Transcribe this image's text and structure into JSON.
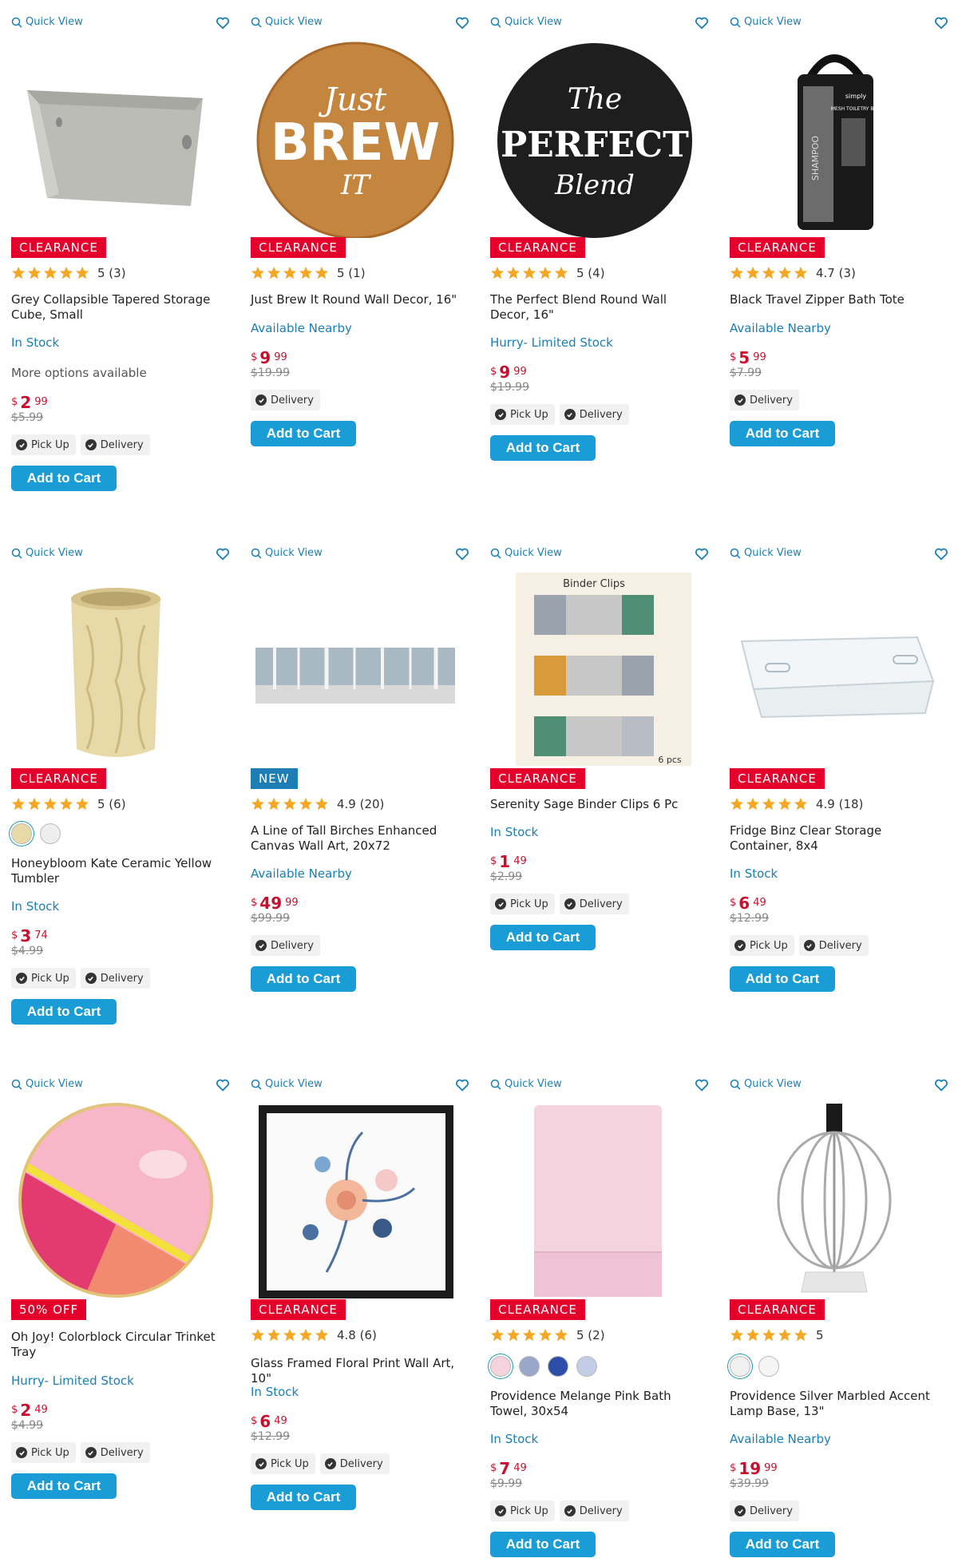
{
  "ui": {
    "quick_view": "Quick View",
    "add_to_cart": "Add to Cart",
    "pick_up": "Pick Up",
    "delivery": "Delivery",
    "more_options": "More options available",
    "currency": "$"
  },
  "colors": {
    "accent": "#1a9cd6",
    "price": "#c8102e",
    "badge_clearance": "#e4002b",
    "badge_new": "#1d7db5",
    "link": "#1a7fb5",
    "star": "#f5a623"
  },
  "products": [
    {
      "badge": "CLEARANCE",
      "badge_type": "clearance",
      "rating_text": "5 (3)",
      "title": "Grey Collapsible Tapered Storage Cube, Small",
      "availability": "In Stock",
      "more_options": true,
      "price_dollars": "2",
      "price_cents": "99",
      "was": "$5.99",
      "fulfillment": [
        "Pick Up",
        "Delivery"
      ],
      "image_icon": "storage-bin-icon"
    },
    {
      "badge": "CLEARANCE",
      "badge_type": "clearance",
      "rating_text": "5 (1)",
      "title": "Just Brew It Round Wall Decor, 16\"",
      "availability": "Available Nearby",
      "price_dollars": "9",
      "price_cents": "99",
      "was": "$19.99",
      "fulfillment": [
        "Delivery"
      ],
      "image_text": [
        "Just",
        "BREW",
        "IT"
      ],
      "image_icon": "wall-decor-icon"
    },
    {
      "badge": "CLEARANCE",
      "badge_type": "clearance",
      "rating_text": "5 (4)",
      "title": "The Perfect Blend Round Wall Decor, 16\"",
      "availability": "Hurry- Limited Stock",
      "price_dollars": "9",
      "price_cents": "99",
      "was": "$19.99",
      "fulfillment": [
        "Pick Up",
        "Delivery"
      ],
      "image_text": [
        "The",
        "PERFECT",
        "Blend"
      ],
      "image_icon": "wall-decor-icon"
    },
    {
      "badge": "CLEARANCE",
      "badge_type": "clearance",
      "rating_text": "4.7 (3)",
      "title": "Black Travel Zipper Bath Tote",
      "availability": "Available Nearby",
      "price_dollars": "5",
      "price_cents": "99",
      "was": "$7.99",
      "fulfillment": [
        "Delivery"
      ],
      "image_text": [
        "SHAMPOO",
        "simply",
        "MESH TOILETRY BAG"
      ],
      "image_icon": "bath-tote-icon"
    },
    {
      "badge": "CLEARANCE",
      "badge_type": "clearance",
      "rating_text": "5 (6)",
      "swatches": [
        "#e8d9a8",
        "#eeeeee"
      ],
      "title": "Honeybloom Kate Ceramic Yellow Tumbler",
      "availability": "In Stock",
      "price_dollars": "3",
      "price_cents": "74",
      "was": "$4.99",
      "fulfillment": [
        "Pick Up",
        "Delivery"
      ],
      "image_icon": "tumbler-icon"
    },
    {
      "badge": "NEW",
      "badge_type": "new",
      "rating_text": "4.9 (20)",
      "title": "A Line of Tall Birches Enhanced Canvas Wall Art, 20x72",
      "availability": "Available Nearby",
      "price_dollars": "49",
      "price_cents": "99",
      "was": "$99.99",
      "fulfillment": [
        "Delivery"
      ],
      "image_icon": "canvas-art-icon"
    },
    {
      "badge": "CLEARANCE",
      "badge_type": "clearance",
      "rating_text": "",
      "title": "Serenity Sage Binder Clips 6 Pc",
      "availability": "In Stock",
      "price_dollars": "1",
      "price_cents": "49",
      "was": "$2.99",
      "fulfillment": [
        "Pick Up",
        "Delivery"
      ],
      "image_text": [
        "Binder Clips",
        "6 pcs"
      ],
      "image_icon": "binder-clips-icon"
    },
    {
      "badge": "CLEARANCE",
      "badge_type": "clearance",
      "rating_text": "4.9 (18)",
      "title": "Fridge Binz Clear Storage Container, 8x4",
      "availability": "In Stock",
      "price_dollars": "6",
      "price_cents": "49",
      "was": "$12.99",
      "fulfillment": [
        "Pick Up",
        "Delivery"
      ],
      "image_icon": "clear-container-icon"
    },
    {
      "badge": "50% OFF",
      "badge_type": "clearance",
      "rating_text": "",
      "title": "Oh Joy! Colorblock Circular Trinket Tray",
      "availability": "Hurry- Limited Stock",
      "price_dollars": "2",
      "price_cents": "49",
      "was": "$4.99",
      "fulfillment": [
        "Pick Up",
        "Delivery"
      ],
      "image_icon": "trinket-tray-icon"
    },
    {
      "badge": "CLEARANCE",
      "badge_type": "clearance",
      "rating_text": "4.8 (6)",
      "title": "Glass Framed Floral Print Wall Art, 10\"",
      "availability": "In Stock",
      "price_dollars": "6",
      "price_cents": "49",
      "was": "$12.99",
      "fulfillment": [
        "Pick Up",
        "Delivery"
      ],
      "image_icon": "framed-floral-icon"
    },
    {
      "badge": "CLEARANCE",
      "badge_type": "clearance",
      "rating_text": "5 (2)",
      "swatches": [
        "#f4d3df",
        "#9aa7c9",
        "#2d4ea8",
        "#c3cde8"
      ],
      "title": "Providence Melange Pink Bath Towel, 30x54",
      "availability": "In Stock",
      "price_dollars": "7",
      "price_cents": "49",
      "was": "$9.99",
      "fulfillment": [
        "Pick Up",
        "Delivery"
      ],
      "image_icon": "bath-towel-icon"
    },
    {
      "badge": "CLEARANCE",
      "badge_type": "clearance",
      "rating_text": "5",
      "swatches": [
        "#f0f0f0",
        "#f5f5f5"
      ],
      "title": "Providence Silver Marbled Accent Lamp Base, 13\"",
      "availability": "Available Nearby",
      "price_dollars": "19",
      "price_cents": "99",
      "was": "$39.99",
      "fulfillment": [
        "Delivery"
      ],
      "image_icon": "lamp-base-icon"
    }
  ]
}
